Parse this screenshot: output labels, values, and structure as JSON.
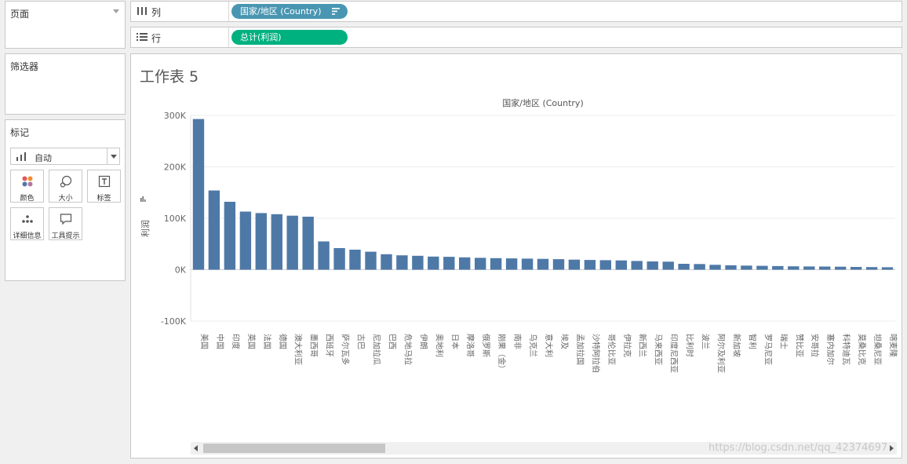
{
  "pages_panel": {
    "title": "页面"
  },
  "filters_panel": {
    "title": "筛选器"
  },
  "marks_panel": {
    "title": "标记",
    "mark_type": "自动",
    "buttons": [
      {
        "label": "颜色",
        "icon": "color-icon"
      },
      {
        "label": "大小",
        "icon": "size-icon"
      },
      {
        "label": "标签",
        "icon": "label-icon"
      },
      {
        "label": "详细信息",
        "icon": "detail-icon"
      },
      {
        "label": "工具提示",
        "icon": "tooltip-icon"
      }
    ]
  },
  "shelves": {
    "columns": {
      "label": "列",
      "pill": "国家/地区 (Country)"
    },
    "rows": {
      "label": "行",
      "pill": "总计(利润)"
    }
  },
  "colors": {
    "bar": "#4e79a7",
    "dimension_pill": "#4996b2",
    "measure_pill": "#00b180"
  },
  "sheet": {
    "title": "工作表 5"
  },
  "chart_data": {
    "type": "bar",
    "title": "",
    "header": "国家/地区 (Country)",
    "xlabel": "",
    "ylabel": "利润",
    "ylim": [
      -100000,
      300000
    ],
    "y_ticks": [
      "300K",
      "200K",
      "100K",
      "0K",
      "-100K"
    ],
    "y_tick_values": [
      300000,
      200000,
      100000,
      0,
      -100000
    ],
    "grid": true,
    "categories": [
      "美国",
      "中国",
      "印度",
      "英国",
      "法国",
      "德国",
      "澳大利亚",
      "墨西哥",
      "西班牙",
      "萨尔瓦多",
      "古巴",
      "尼加拉瓜",
      "巴西",
      "危地马拉",
      "伊朗",
      "奥地利",
      "日本",
      "摩洛哥",
      "俄罗斯",
      "刚果（金）",
      "南非",
      "乌克兰",
      "意大利",
      "埃及",
      "孟加拉国",
      "沙特阿拉伯",
      "哥伦比亚",
      "伊拉克",
      "新西兰",
      "马来西亚",
      "印度尼西亚",
      "比利时",
      "波兰",
      "阿尔及利亚",
      "新加坡",
      "智利",
      "罗马尼亚",
      "瑞士",
      "赞比亚",
      "安哥拉",
      "塞内加尔",
      "科特迪瓦",
      "莫桑比克",
      "坦桑尼亚",
      "喀麦隆"
    ],
    "values": [
      293000,
      154000,
      132000,
      113000,
      110000,
      108000,
      105000,
      103000,
      55000,
      42000,
      39000,
      35000,
      30000,
      28000,
      27000,
      25500,
      25000,
      24000,
      23000,
      22500,
      22000,
      21500,
      21000,
      20500,
      19500,
      19000,
      18500,
      18000,
      17000,
      16000,
      15500,
      11500,
      11000,
      9500,
      8500,
      8000,
      7500,
      7000,
      6500,
      6300,
      6100,
      5800,
      5300,
      5000,
      4800
    ]
  },
  "watermark": "https://blog.csdn.net/qq_42374697"
}
